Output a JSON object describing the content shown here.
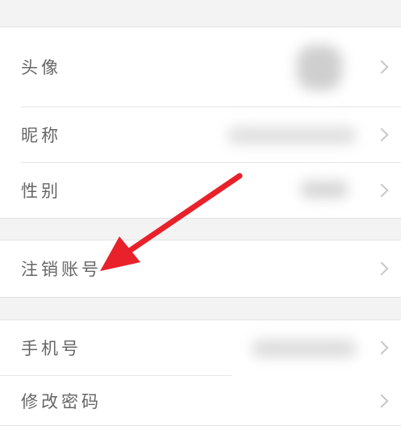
{
  "profile": {
    "avatar_label": "头像",
    "nickname_label": "昵称",
    "gender_label": "性别"
  },
  "account": {
    "delete_account_label": "注销账号"
  },
  "security": {
    "phone_label": "手机号",
    "password_label": "修改密码"
  },
  "annotation": {
    "arrow_color": "#e8212b"
  }
}
